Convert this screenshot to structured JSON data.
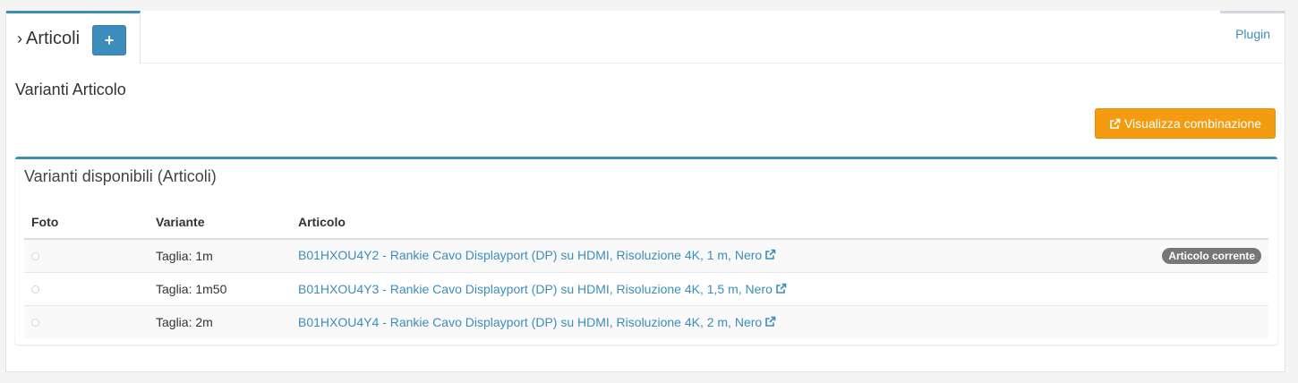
{
  "tabs": {
    "active_title": "Articoli",
    "add_symbol": "+",
    "plugin_label": "Plugin"
  },
  "page": {
    "section_title": "Varianti Articolo",
    "combo_button_label": "Visualizza combinazione"
  },
  "variants_box": {
    "title": "Varianti disponibili (Articoli)",
    "columns": [
      "Foto",
      "Variante",
      "Articolo"
    ],
    "rows": [
      {
        "variante": "Taglia: 1m",
        "articolo": "B01HXOU4Y2 - Rankie Cavo Displayport (DP) su HDMI, Risoluzione 4K, 1 m, Nero",
        "badge": "Articolo corrente"
      },
      {
        "variante": "Taglia: 1m50",
        "articolo": "B01HXOU4Y3 - Rankie Cavo Displayport (DP) su HDMI, Risoluzione 4K, 1,5 m, Nero",
        "badge": ""
      },
      {
        "variante": "Taglia: 2m",
        "articolo": "B01HXOU4Y4 - Rankie Cavo Displayport (DP) su HDMI, Risoluzione 4K, 2 m, Nero",
        "badge": ""
      }
    ]
  },
  "colors": {
    "primary": "#3c8dbc",
    "warning": "#f39c12",
    "badge": "#777777"
  },
  "icons": {
    "tab_chevron": "chevron-right-icon",
    "combo_button": "external-link-icon",
    "article_link": "external-link-icon"
  }
}
